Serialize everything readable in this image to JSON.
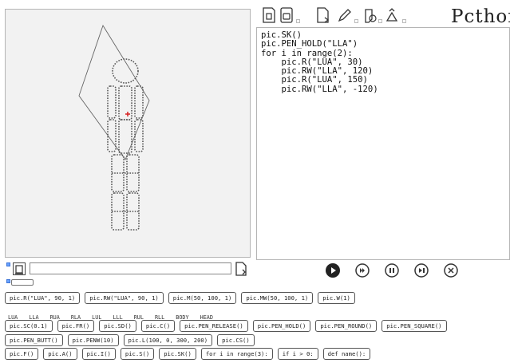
{
  "toolbar": {
    "icons": [
      "new-file-icon",
      "save-file-icon",
      "export-file-icon",
      "pencil-icon",
      "eraser-icon",
      "clear-icon"
    ],
    "logo_text": "Pcthon"
  },
  "editor": {
    "code_lines": [
      "pic.SK()",
      "pic.PEN_HOLD(\"LLA\")",
      "for i in range(2):",
      "    pic.R(\"LUA\", 30)",
      "    pic.RW(\"LLA\", 120)",
      "    pic.R(\"LUA\", 150)",
      "    pic.RW(\"LLA\", -120)"
    ]
  },
  "command": {
    "value": "",
    "placeholder": ""
  },
  "controls": [
    "play-icon",
    "skip-forward-icon",
    "pause-icon",
    "step-icon",
    "close-icon"
  ],
  "accent": "#d62020",
  "chips_row1": [
    "pic.R(\"LUA\", 90, 1)",
    "pic.RW(\"LUA\", 90, 1)",
    "pic.M(50, 100, 1)",
    "pic.MW(50, 100, 1)",
    "pic.W(1)"
  ],
  "parts": [
    "LUA",
    "LLA",
    "RUA",
    "RLA",
    "LUL",
    "LLL",
    "RUL",
    "RLL",
    "BODY",
    "HEAD"
  ],
  "chips_row2": [
    "pic.SC(0.1)",
    "pic.FR()",
    "pic.SD()",
    "pic.C()",
    "pic.PEN_RELEASE()",
    "pic.PEN_HOLD()",
    "pic.PEN_ROUND()",
    "pic.PEN_SQUARE()"
  ],
  "chips_row3": [
    "pic.PEN_BUTT()",
    "pic.PENW(10)",
    "pic.L(100, 0, 300, 200)",
    "pic.CS()"
  ],
  "chips_row4": [
    "pic.F()",
    "pic.A()",
    "pic.I()",
    "pic.S()",
    "pic.SK()",
    "for i in range(3):",
    "if i > 0:",
    "def name():"
  ]
}
